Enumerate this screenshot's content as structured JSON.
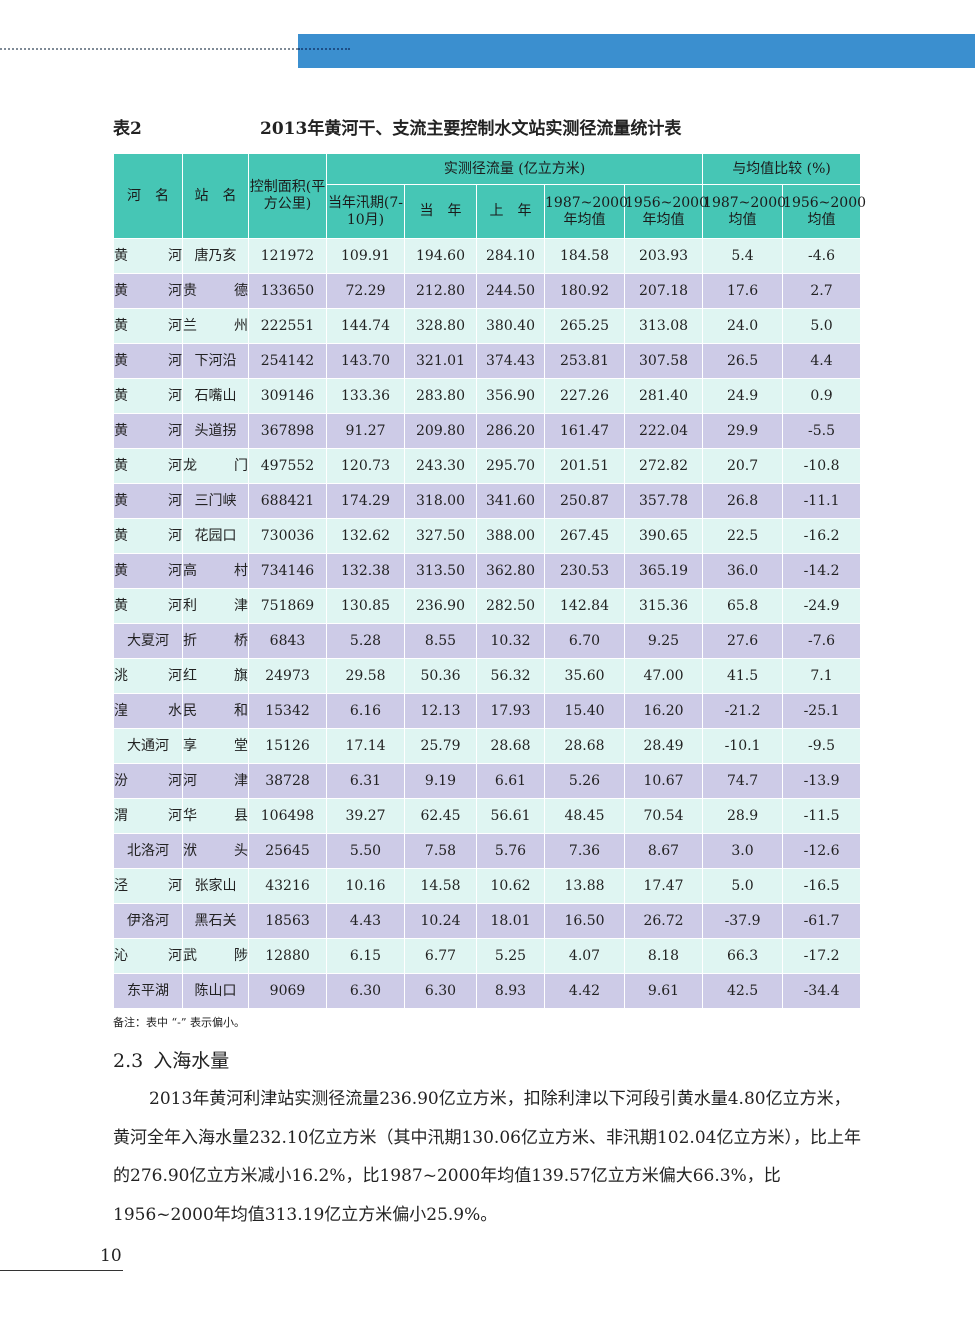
{
  "table": {
    "label": "表2",
    "title": "2013年黄河干、支流主要控制水文站实测径流量统计表",
    "headers": {
      "river": "河　名",
      "station": "站　名",
      "area": "控制面积(平方公里)",
      "runoff_group": "实测径流量 (亿立方米)",
      "compare_group": "与均值比较 (%)",
      "flood_season": "当年汛期(7-10月)",
      "this_year": "当　年",
      "last_year": "上　年",
      "avg_1987_2000": "1987~2000年均值",
      "avg_1956_2000": "1956~2000年均值",
      "cmp_1987_2000": "1987~2000均值",
      "cmp_1956_2000": "1956~2000均值"
    },
    "rows": [
      [
        "黄河",
        "唐乃亥",
        "121972",
        "109.91",
        "194.60",
        "284.10",
        "184.58",
        "203.93",
        "5.4",
        "-4.6"
      ],
      [
        "黄河",
        "贵德",
        "133650",
        "72.29",
        "212.80",
        "244.50",
        "180.92",
        "207.18",
        "17.6",
        "2.7"
      ],
      [
        "黄河",
        "兰州",
        "222551",
        "144.74",
        "328.80",
        "380.40",
        "265.25",
        "313.08",
        "24.0",
        "5.0"
      ],
      [
        "黄河",
        "下河沿",
        "254142",
        "143.70",
        "321.01",
        "374.43",
        "253.81",
        "307.58",
        "26.5",
        "4.4"
      ],
      [
        "黄河",
        "石嘴山",
        "309146",
        "133.36",
        "283.80",
        "356.90",
        "227.26",
        "281.40",
        "24.9",
        "0.9"
      ],
      [
        "黄河",
        "头道拐",
        "367898",
        "91.27",
        "209.80",
        "286.20",
        "161.47",
        "222.04",
        "29.9",
        "-5.5"
      ],
      [
        "黄河",
        "龙门",
        "497552",
        "120.73",
        "243.30",
        "295.70",
        "201.51",
        "272.82",
        "20.7",
        "-10.8"
      ],
      [
        "黄河",
        "三门峡",
        "688421",
        "174.29",
        "318.00",
        "341.60",
        "250.87",
        "357.78",
        "26.8",
        "-11.1"
      ],
      [
        "黄河",
        "花园口",
        "730036",
        "132.62",
        "327.50",
        "388.00",
        "267.45",
        "390.65",
        "22.5",
        "-16.2"
      ],
      [
        "黄河",
        "高村",
        "734146",
        "132.38",
        "313.50",
        "362.80",
        "230.53",
        "365.19",
        "36.0",
        "-14.2"
      ],
      [
        "黄河",
        "利津",
        "751869",
        "130.85",
        "236.90",
        "282.50",
        "142.84",
        "315.36",
        "65.8",
        "-24.9"
      ],
      [
        "大夏河",
        "折桥",
        "6843",
        "5.28",
        "8.55",
        "10.32",
        "6.70",
        "9.25",
        "27.6",
        "-7.6"
      ],
      [
        "洮河",
        "红旗",
        "24973",
        "29.58",
        "50.36",
        "56.32",
        "35.60",
        "47.00",
        "41.5",
        "7.1"
      ],
      [
        "湟水",
        "民和",
        "15342",
        "6.16",
        "12.13",
        "17.93",
        "15.40",
        "16.20",
        "-21.2",
        "-25.1"
      ],
      [
        "大通河",
        "享堂",
        "15126",
        "17.14",
        "25.79",
        "28.68",
        "28.68",
        "28.49",
        "-10.1",
        "-9.5"
      ],
      [
        "汾河",
        "河津",
        "38728",
        "6.31",
        "9.19",
        "6.61",
        "5.26",
        "10.67",
        "74.7",
        "-13.9"
      ],
      [
        "渭河",
        "华县",
        "106498",
        "39.27",
        "62.45",
        "56.61",
        "48.45",
        "70.54",
        "28.9",
        "-11.5"
      ],
      [
        "北洛河",
        "洑头",
        "25645",
        "5.50",
        "7.58",
        "5.76",
        "7.36",
        "8.67",
        "3.0",
        "-12.6"
      ],
      [
        "泾河",
        "张家山",
        "43216",
        "10.16",
        "14.58",
        "10.62",
        "13.88",
        "17.47",
        "5.0",
        "-16.5"
      ],
      [
        "伊洛河",
        "黑石关",
        "18563",
        "4.43",
        "10.24",
        "18.01",
        "16.50",
        "26.72",
        "-37.9",
        "-61.7"
      ],
      [
        "沁河",
        "武陟",
        "12880",
        "6.15",
        "6.77",
        "5.25",
        "4.07",
        "8.18",
        "66.3",
        "-17.2"
      ],
      [
        "东平湖",
        "陈山口",
        "9069",
        "6.30",
        "6.30",
        "8.93",
        "4.42",
        "9.61",
        "42.5",
        "-34.4"
      ]
    ],
    "footnote": "备注：表中 “-” 表示偏小。"
  },
  "section": {
    "number": "2.3",
    "title": "入海水量",
    "paragraph": "2013年黄河利津站实测径流量236.90亿立方米，扣除利津以下河段引黄水量4.80亿立方米，黄河全年入海水量232.10亿立方米（其中汛期130.06亿立方米、非汛期102.04亿立方米），比上年的276.90亿立方米减小16.2%，比1987~2000年均值139.57亿立方米偏大66.3%，比1956~2000年均值313.19亿立方米偏小25.9%。"
  },
  "page_number": "10",
  "colors": {
    "header_bar": "#3b8fcf",
    "table_header": "#46c6b5",
    "row_light": "#dff5f2",
    "row_purple": "#cdcbe7"
  }
}
